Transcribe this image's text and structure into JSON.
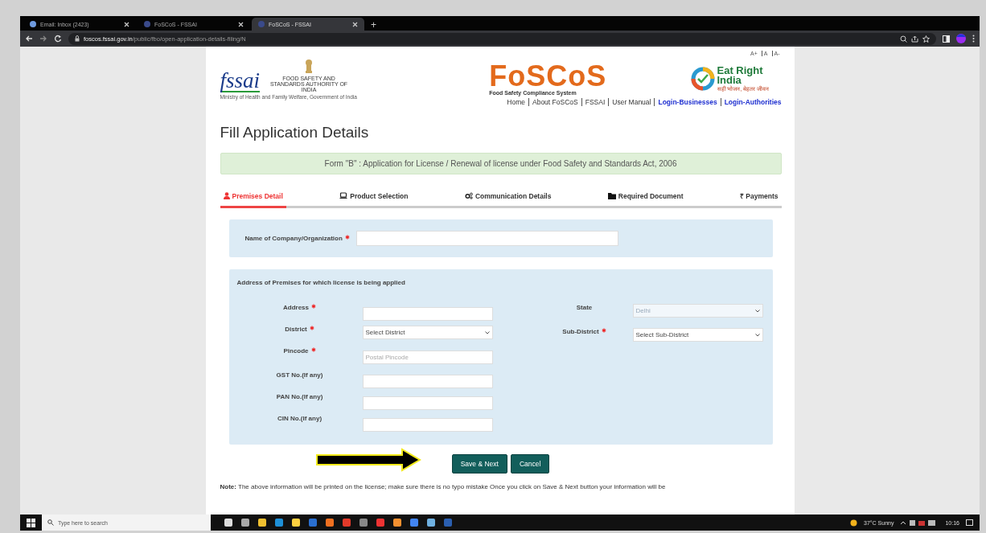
{
  "browser": {
    "tabs": [
      {
        "title": "Email: Inbox (2423)",
        "selected": false
      },
      {
        "title": "FoSCoS - FSSAI",
        "selected": false
      },
      {
        "title": "FoSCoS - FSSAI",
        "selected": true
      }
    ],
    "new_tab": "+",
    "url_host": "foscos.fssai.gov.in",
    "url_path": "/public/fbo/open-application-details-filing/N"
  },
  "header": {
    "font_sizes": [
      "A+",
      "A",
      "A-"
    ],
    "fssai_logo": "fssai",
    "authority": "FOOD SAFETY AND STANDARDS AUTHORITY OF INDIA",
    "ministry": "Ministry of Health and Family Welfare, Government of India",
    "brand": "FoSCoS",
    "brand_sub": "Food Safety Compliance System",
    "eat_right": "Eat Right India",
    "eat_right_tagline": "सही भोजन, बेहतर जीवन",
    "nav": [
      {
        "label": "Home",
        "kind": "plain"
      },
      {
        "label": "About FoSCoS",
        "kind": "plain"
      },
      {
        "label": "FSSAI",
        "kind": "plain"
      },
      {
        "label": "User Manual",
        "kind": "plain"
      },
      {
        "label": "Login-Businesses",
        "kind": "login"
      },
      {
        "label": "Login-Authorities",
        "kind": "login"
      }
    ]
  },
  "page_title": "Fill Application Details",
  "banner": "Form \"B\" : Application for License / Renewal of license under Food Safety and Standards Act, 2006",
  "steps": [
    {
      "label": "Premises Detail",
      "kind": "user",
      "selected": true
    },
    {
      "label": "Product Selection",
      "kind": "laptop",
      "selected": false
    },
    {
      "label": "Communication Details",
      "kind": "gears",
      "selected": false
    },
    {
      "label": "Required Document",
      "kind": "folder",
      "selected": false
    },
    {
      "label": "₹ Payments",
      "kind": "plain",
      "selected": false
    }
  ],
  "company": {
    "label": "Name of Company/Organization",
    "required": true
  },
  "address_section": {
    "title": "Address of Premises for which license is being applied",
    "left": [
      {
        "label": "Address",
        "required": true,
        "kind": "text"
      },
      {
        "label": "District",
        "required": true,
        "kind": "select",
        "value": "Select District"
      },
      {
        "label": "Pincode",
        "required": true,
        "kind": "text",
        "placeholder": "Postal Pincode"
      },
      {
        "label": "GST No.(If any)",
        "required": false,
        "kind": "text"
      },
      {
        "label": "PAN No.(If any)",
        "required": false,
        "kind": "text"
      },
      {
        "label": "CIN No.(If any)",
        "required": false,
        "kind": "text"
      }
    ],
    "right": [
      {
        "label": "State",
        "required": false,
        "kind": "select",
        "value": "Delhi",
        "disabled": true
      },
      {
        "label": "Sub-District",
        "required": true,
        "kind": "select",
        "value": "Select Sub-District",
        "disabled": false
      }
    ]
  },
  "buttons": [
    "Save & Next",
    "Cancel"
  ],
  "note": "**Note:** The above information will be printed on the license; make sure there is no typo mistake Once you click on Save & Next button your information will be",
  "taskbar": {
    "search_placeholder": "Type here to search",
    "weather": "37°C Sunny",
    "time": "10:16"
  }
}
